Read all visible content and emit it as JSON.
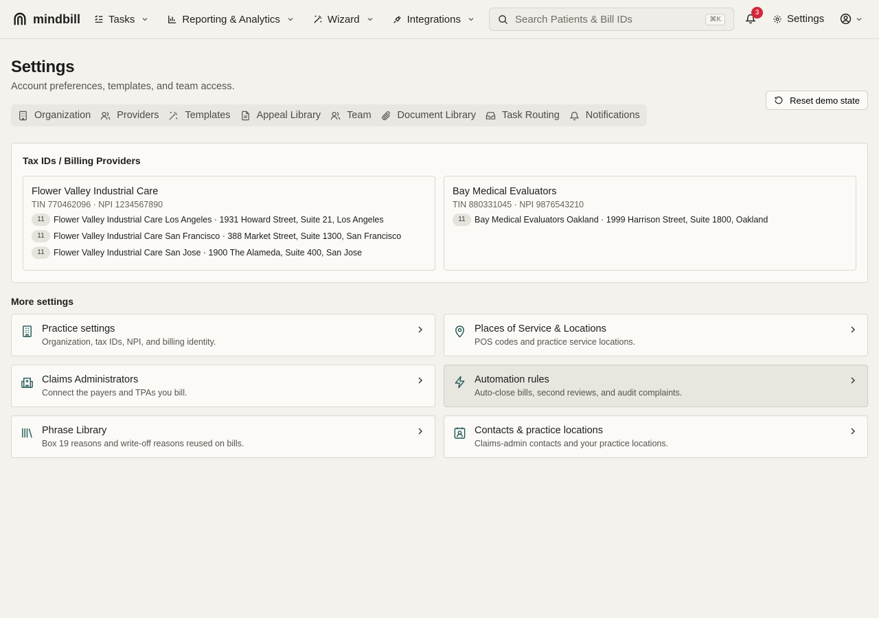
{
  "app": {
    "brand": "mindbill"
  },
  "nav": [
    {
      "label": "Tasks",
      "icon": "tasks-icon"
    },
    {
      "label": "Reporting & Analytics",
      "icon": "bar-chart-icon"
    },
    {
      "label": "Wizard",
      "icon": "wand-icon"
    },
    {
      "label": "Integrations",
      "icon": "plug-icon"
    }
  ],
  "search": {
    "placeholder": "Search Patients & Bill IDs",
    "shortcut": "⌘K"
  },
  "notifications": {
    "count": "3"
  },
  "header": {
    "settings_label": "Settings"
  },
  "page": {
    "title": "Settings",
    "subtitle": "Account preferences, templates, and team access.",
    "reset_label": "Reset demo state"
  },
  "tabs": [
    {
      "label": "Organization"
    },
    {
      "label": "Providers"
    },
    {
      "label": "Templates"
    },
    {
      "label": "Appeal Library"
    },
    {
      "label": "Team"
    },
    {
      "label": "Document Library"
    },
    {
      "label": "Task Routing"
    },
    {
      "label": "Notifications"
    }
  ],
  "tax": {
    "title": "Tax IDs / Billing Providers",
    "providers": [
      {
        "name": "Flower Valley Industrial Care",
        "ids": "TIN 770462096 · NPI 1234567890",
        "locations": [
          {
            "pos": "11",
            "text": "Flower Valley Industrial Care Los Angeles · 1931 Howard Street, Suite 21, Los Angeles"
          },
          {
            "pos": "11",
            "text": "Flower Valley Industrial Care San Francisco · 388 Market Street, Suite 1300, San Francisco"
          },
          {
            "pos": "11",
            "text": "Flower Valley Industrial Care San Jose · 1900 The Alameda, Suite 400, San Jose"
          }
        ]
      },
      {
        "name": "Bay Medical Evaluators",
        "ids": "TIN 880331045 · NPI 9876543210",
        "locations": [
          {
            "pos": "11",
            "text": "Bay Medical Evaluators Oakland · 1999 Harrison Street, Suite 1800, Oakland"
          }
        ]
      }
    ]
  },
  "more": {
    "title": "More settings",
    "cards": [
      {
        "title": "Practice settings",
        "desc": "Organization, tax IDs, NPI, and billing identity.",
        "icon": "building-icon"
      },
      {
        "title": "Places of Service & Locations",
        "desc": "POS codes and practice service locations.",
        "icon": "map-pin-icon"
      },
      {
        "title": "Claims Administrators",
        "desc": "Connect the payers and TPAs you bill.",
        "icon": "hospital-icon"
      },
      {
        "title": "Automation rules",
        "desc": "Auto-close bills, second reviews, and audit complaints.",
        "icon": "lightning-icon"
      },
      {
        "title": "Phrase Library",
        "desc": "Box 19 reasons and write-off reasons reused on bills.",
        "icon": "library-icon"
      },
      {
        "title": "Contacts & practice locations",
        "desc": "Claims-admin contacts and your practice locations.",
        "icon": "contact-icon"
      }
    ]
  },
  "colors": {
    "accent": "#1f5656",
    "badge": "#d3273b",
    "background": "#f4f2ed"
  }
}
